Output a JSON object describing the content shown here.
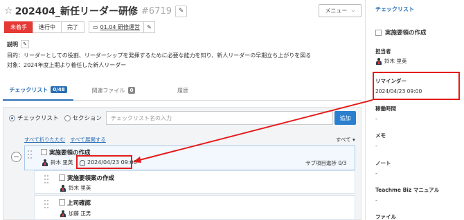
{
  "header": {
    "title": "202404_新任リーダー研修",
    "id": "#6719",
    "menu_label": "メニュー"
  },
  "status": [
    "未着手",
    "進行中",
    "完了"
  ],
  "folder": "01.04 研修運営",
  "description": {
    "label": "説明",
    "line1": "目的：リーダーとしての役割、リーダーシップを発揮するために必要な能力を知り、新人リーダーの早期立ち上がりを図る",
    "line2": "対象：2024年度上期より着任した新人リーダー"
  },
  "tabs": [
    {
      "label": "チェックリスト",
      "count": "0/48"
    },
    {
      "label": "関連ファイル",
      "count": "0"
    },
    {
      "label": "履歴"
    }
  ],
  "panel": {
    "radio_checklist": "チェックリスト",
    "radio_section": "セクション",
    "input_placeholder": "チェックリスト名の入力",
    "add_label": "追加",
    "collapse_all": "すべて折りたたむ",
    "expand_all": "すべて展開する",
    "filter_all": "すべて ▾"
  },
  "items": [
    {
      "title": "実施要領の作成",
      "person": "鈴木 里英",
      "reminder": "2024/04/23 09:00",
      "progress": "サブ項目進捗 0/3"
    },
    {
      "title": "実施要領案の作成",
      "person": "鈴木 里英"
    },
    {
      "title": "上司確認",
      "person": "加藤 正男"
    }
  ],
  "sidebar": {
    "heading": "チェックリスト",
    "item_title": "実施要領の作成",
    "fields": [
      {
        "label": "担当者",
        "value": "鈴木 里英"
      },
      {
        "label": "リマインダー",
        "value": "2024/04/23 09:00"
      },
      {
        "label": "稼働時間",
        "value": "-"
      },
      {
        "label": "メモ",
        "value": "-"
      },
      {
        "label": "ノート",
        "value": "-"
      },
      {
        "label": "Teachme Biz マニュアル",
        "value": "-"
      },
      {
        "label": "ファイル",
        "value": ""
      }
    ]
  },
  "colors": {
    "accent": "#2a6fb5",
    "status_active": "#e53935",
    "annotation": "#e31b1b"
  }
}
